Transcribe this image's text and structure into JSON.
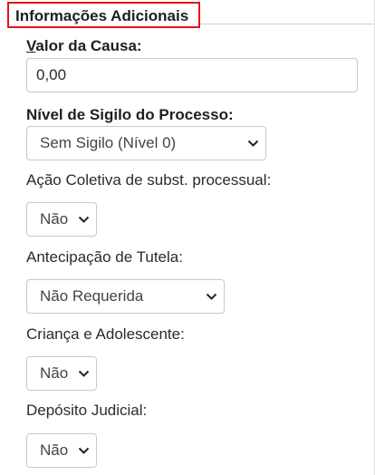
{
  "section": {
    "title": "Informações Adicionais"
  },
  "valor_causa": {
    "label_first": "V",
    "label_rest": "alor da Causa:",
    "value": "0,00"
  },
  "nivel_sigilo": {
    "label": "Nível de Sigilo do Processo:",
    "selected": "Sem Sigilo (Nível 0)"
  },
  "acao_coletiva": {
    "label": "Ação Coletiva de subst. processual:",
    "selected": "Não"
  },
  "antecipacao_tutela": {
    "label": "Antecipação de Tutela:",
    "selected": "Não Requerida"
  },
  "crianca_adolescente": {
    "label": "Criança e Adolescente:",
    "selected": "Não"
  },
  "deposito_judicial": {
    "label": "Depósito Judicial:",
    "selected": "Não"
  },
  "colors": {
    "highlight_border": "#e3141b",
    "field_border": "#c8c8c8"
  },
  "icons": {
    "dropdown": "chevron-down-icon"
  }
}
